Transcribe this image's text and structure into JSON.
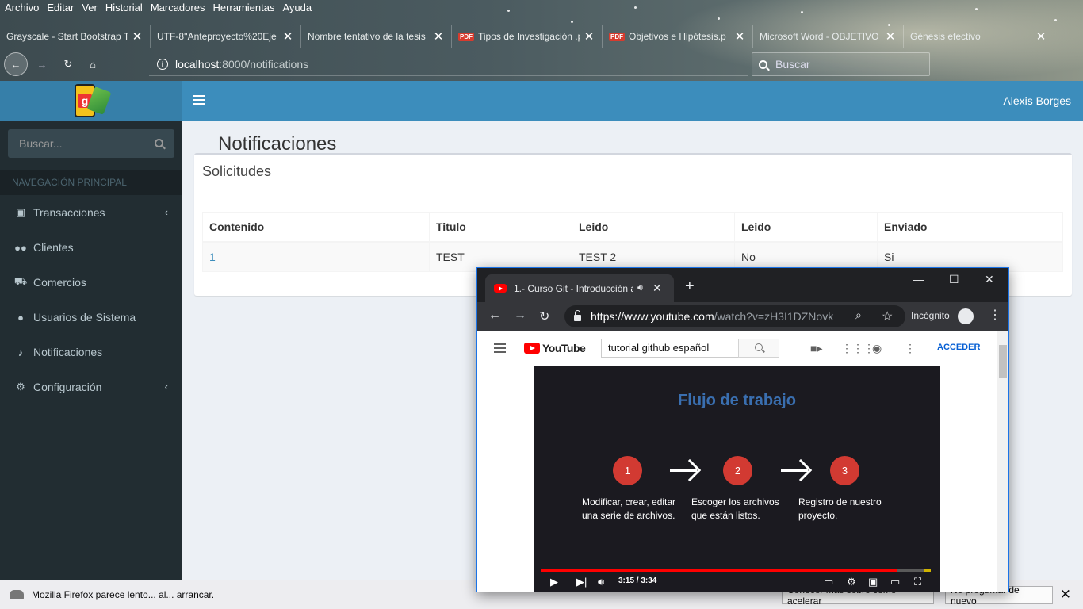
{
  "firefox": {
    "menu": [
      "Archivo",
      "Editar",
      "Ver",
      "Historial",
      "Marcadores",
      "Herramientas",
      "Ayuda"
    ],
    "tabs": [
      {
        "label": "Grayscale - Start Bootstrap Th",
        "pdf": false
      },
      {
        "label": "UTF-8''Anteproyecto%20Eje",
        "pdf": false
      },
      {
        "label": "Nombre tentativo de la tesis",
        "pdf": false
      },
      {
        "label": "Tipos de Investigación .p",
        "pdf": true
      },
      {
        "label": "Objetivos e Hipótesis.p",
        "pdf": true
      },
      {
        "label": "Microsoft Word - OBJETIVO",
        "pdf": false
      },
      {
        "label": "Génesis efectivo",
        "pdf": false
      }
    ],
    "url_host": "localhost",
    "url_path": ":8000/notifications",
    "search_placeholder": "Buscar",
    "notification": {
      "text": "Mozilla Firefox parece lento... al... arrancar.",
      "learn_more": "Conocer más sobre cómo acelerar",
      "dont_ask": "No preguntar de nuevo"
    }
  },
  "app": {
    "user_name": "Alexis Borges",
    "logo_letter": "g",
    "sidebar": {
      "search_placeholder": "Buscar...",
      "header": "NAVEGACIÓN PRINCIPAL",
      "items": [
        {
          "label": "Transacciones",
          "icon": "money-icon",
          "caret": true
        },
        {
          "label": "Clientes",
          "icon": "users-icon",
          "caret": false
        },
        {
          "label": "Comercios",
          "icon": "cart-icon",
          "caret": false
        },
        {
          "label": "Usuarios de Sistema",
          "icon": "user-icon",
          "caret": false
        },
        {
          "label": "Notificaciones",
          "icon": "bell-icon",
          "caret": false
        },
        {
          "label": "Configuración",
          "icon": "gears-icon",
          "caret": true
        }
      ]
    },
    "page_title": "Notificaciones",
    "box_title": "Solicitudes",
    "table": {
      "headers": [
        "Contenido",
        "Titulo",
        "Leido",
        "Leido",
        "Enviado"
      ],
      "rows": [
        [
          "1",
          "TEST",
          "TEST 2",
          "No",
          "Si"
        ]
      ]
    }
  },
  "chrome": {
    "tab_title": "1.- Curso Git - Introducción a",
    "url_main": "https://www.youtube.com",
    "url_rest": "/watch?v=zH3I1DZNovk",
    "incognito_label": "Incógnito",
    "youtube": {
      "logo_text": "YouTube",
      "search_value": "tutorial github español",
      "signin": "ACCEDER",
      "video": {
        "title": "Flujo de trabajo",
        "steps": [
          {
            "num": "1",
            "text": "Modificar, crear, editar una serie de archivos."
          },
          {
            "num": "2",
            "text": "Escoger los archivos que están listos."
          },
          {
            "num": "3",
            "text": "Registro de nuestro proyecto."
          }
        ],
        "time": "3:15 / 3:34",
        "progress": 0.915
      }
    }
  },
  "colors": {
    "header_blue": "#3c8dbc",
    "sidebar_dark": "#222d32",
    "youtube_red": "#ff0000",
    "step_red": "#d23a32"
  }
}
